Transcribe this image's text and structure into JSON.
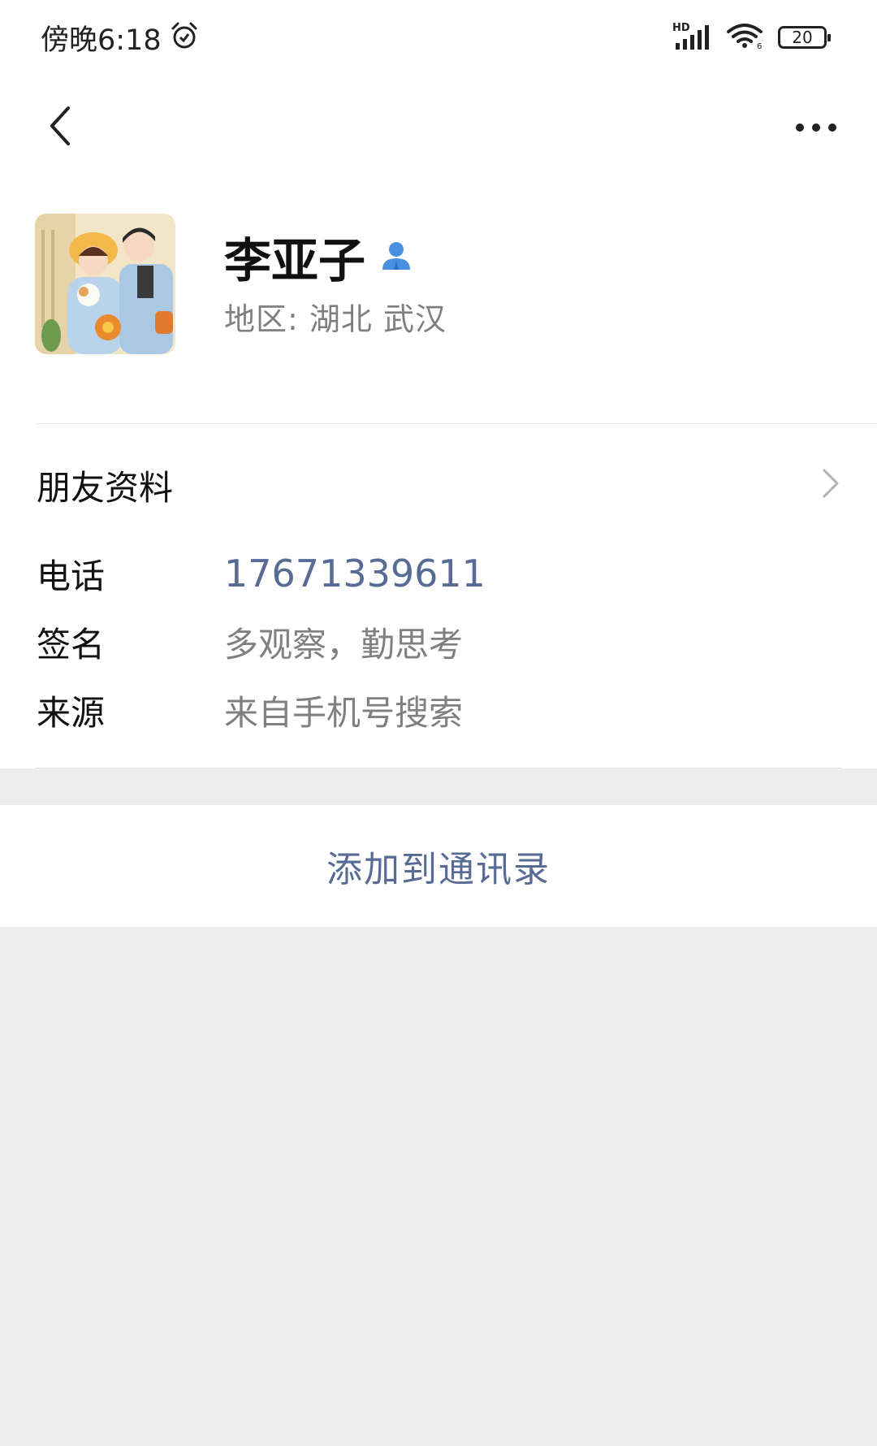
{
  "status_bar": {
    "time": "傍晚6:18",
    "alarm_icon": "alarm-clock-icon",
    "network_label": "HD",
    "battery_level": "20"
  },
  "nav": {
    "back_icon": "chevron-left-icon",
    "more_icon": "more-dots-icon"
  },
  "profile": {
    "name": "李亚子",
    "gender_icon": "person-icon",
    "gender_icon_color": "#4a90e2",
    "region": "地区:  湖北  武汉"
  },
  "info": {
    "friend_info_label": "朋友资料",
    "rows": [
      {
        "label": "电话",
        "value": "17671339611"
      },
      {
        "label": "签名",
        "value": "多观察，勤思考"
      },
      {
        "label": "来源",
        "value": "来自手机号搜索"
      }
    ]
  },
  "actions": {
    "add_to_contacts": "添加到通讯录",
    "link_color": "#576b95"
  }
}
